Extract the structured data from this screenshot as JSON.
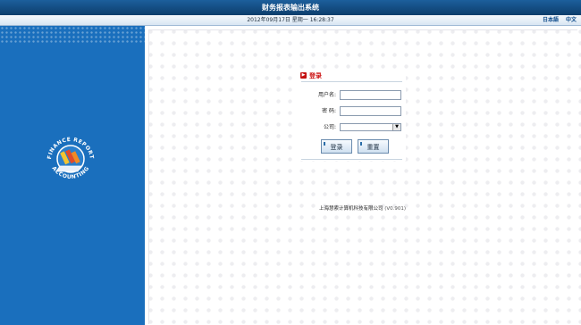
{
  "header": {
    "title": "财务报表输出系统"
  },
  "infobar": {
    "datetime": "2012年09月17日 星期一 16:28:37",
    "lang_ja": "日本語",
    "lang_zh": "中文"
  },
  "login": {
    "title": "登录",
    "username_label": "用户名:",
    "password_label": "密 码:",
    "company_label": "公司:",
    "username_value": "",
    "password_value": "",
    "company_value": "",
    "login_button": "登录",
    "reset_button": "重置"
  },
  "logo": {
    "ring_text_top": "FINANCE REPORT",
    "ring_text_bottom": "ACCOUNTING"
  },
  "footer": {
    "company": "上海慧索计算机科技有限公司",
    "version": "(V0.901)"
  },
  "colors": {
    "sidebar": "#1a6fbd",
    "header": "#0d3e6c",
    "accent_red": "#cc1111"
  }
}
